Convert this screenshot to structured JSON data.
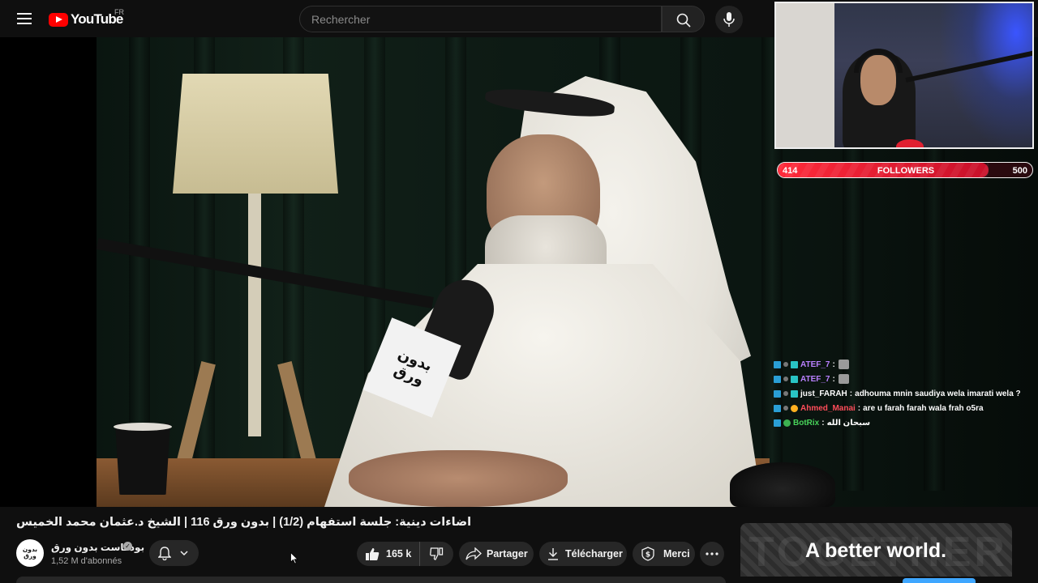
{
  "header": {
    "logo_text": "YouTube",
    "region_code": "FR",
    "search_placeholder": "Rechercher"
  },
  "video": {
    "mic_flag_text": [
      "بدون",
      "ورق"
    ]
  },
  "stream_overlay": {
    "followers": {
      "current": 414,
      "label": "FOLLOWERS",
      "goal": 500,
      "progress_fraction": 0.828
    },
    "chat": [
      {
        "user": "ATEF_7",
        "separator": ":",
        "message": "",
        "emote": true,
        "user_color": "#b980ff"
      },
      {
        "user": "ATEF_7",
        "separator": ":",
        "message": "",
        "emote": true,
        "user_color": "#b980ff"
      },
      {
        "user": "just_FARAH",
        "separator": ":",
        "message": "adhouma mnin saudiya wela imarati wela ?",
        "emote": false,
        "user_color": "#ffffff"
      },
      {
        "user": "Ahmed_Manai",
        "separator": ":",
        "message": "are u farah farah wala frah o5ra",
        "emote": false,
        "user_color": "#ff4d5a"
      },
      {
        "user": "BotRix",
        "separator": ":",
        "message": "سبحان الله",
        "emote": false,
        "user_color": "#48d35a"
      }
    ]
  },
  "details": {
    "title": "اضاءات دينية: جلسة استفهام (1/2) | بدون ورق 116 | الشيخ د.عثمان محمد الخميس",
    "channel": {
      "avatar_text": [
        "بدون",
        "ورق"
      ],
      "name": "بودكاست بدون ورق",
      "verified_mark": "✓",
      "subscribers": "1,52 M d'abonnés"
    },
    "actions": {
      "like_count": "165 k",
      "share_label": "Partager",
      "download_label": "Télécharger",
      "thanks_label": "Merci"
    }
  },
  "ad": {
    "background_word": "TOGETHER",
    "headline": "A better world."
  },
  "colors": {
    "brand_red": "#ff0000",
    "followers_bar": "#ff2a3a",
    "ad_button": "#3ea6ff"
  }
}
